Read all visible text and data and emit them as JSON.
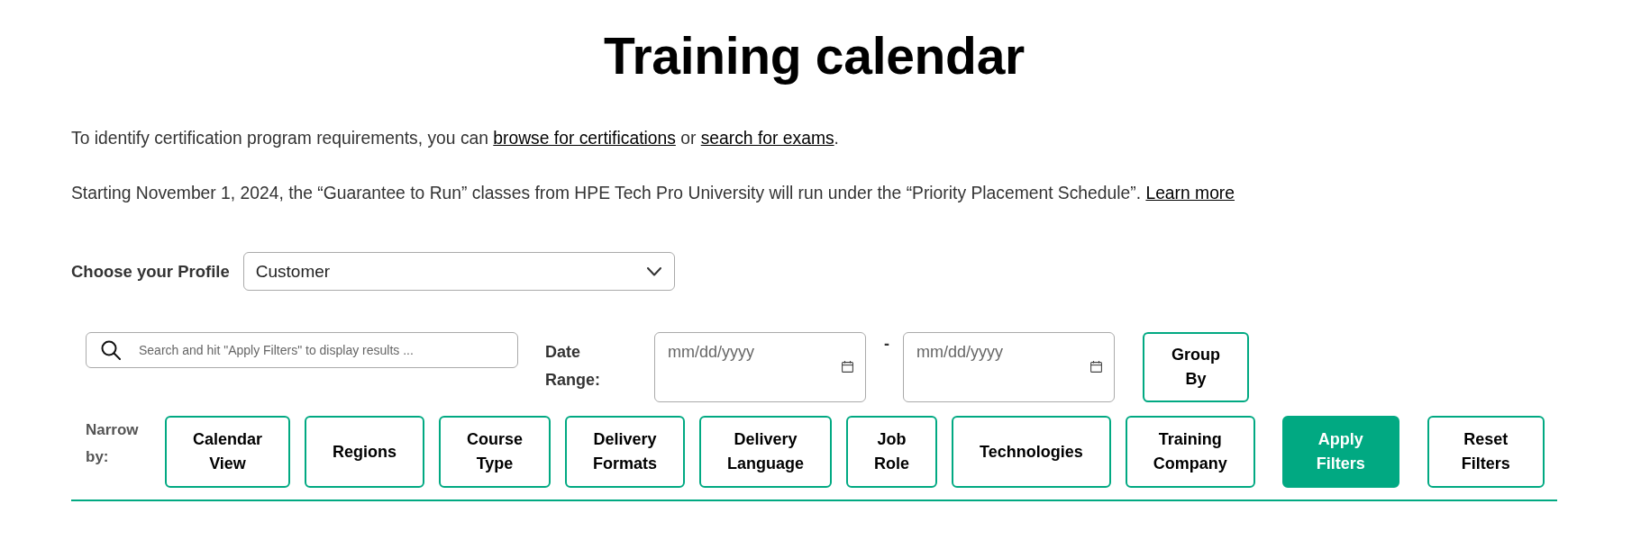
{
  "page": {
    "title": "Training calendar"
  },
  "intro": [
    {
      "segments": [
        {
          "kind": "text",
          "text": "To identify certification program requirements, you can "
        },
        {
          "kind": "link",
          "text": "browse for certifications"
        },
        {
          "kind": "text",
          "text": " or "
        },
        {
          "kind": "link",
          "text": "search for exams"
        },
        {
          "kind": "text",
          "text": "."
        }
      ]
    },
    {
      "segments": [
        {
          "kind": "text",
          "text": "Starting November 1, 2024, the “Guarantee to Run” classes from HPE Tech Pro University will run under the “Priority Placement Schedule”. "
        },
        {
          "kind": "link",
          "text": "Learn more"
        }
      ]
    }
  ],
  "profile": {
    "label": "Choose your Profile",
    "value": "Customer"
  },
  "search": {
    "placeholder": "Search and hit \"Apply Filters\" to display results ..."
  },
  "date_range": {
    "label": "Date Range:",
    "from": {
      "placeholder": "mm/dd/yyyy"
    },
    "separator": "-",
    "to": {
      "placeholder": "mm/dd/yyyy"
    }
  },
  "group_by": {
    "label": "Group By"
  },
  "narrow_by": {
    "label": "Narrow by:",
    "filters": [
      {
        "label": "Calendar View"
      },
      {
        "label": "Regions"
      },
      {
        "label": "Course Type"
      },
      {
        "label": "Delivery Formats"
      },
      {
        "label": "Delivery Language"
      },
      {
        "label": "Job Role"
      },
      {
        "label": "Technologies"
      },
      {
        "label": "Training Company"
      }
    ]
  },
  "actions": [
    {
      "kind": "primary",
      "label": "Apply Filters"
    },
    {
      "kind": "secondary",
      "label": "Reset Filters"
    }
  ]
}
